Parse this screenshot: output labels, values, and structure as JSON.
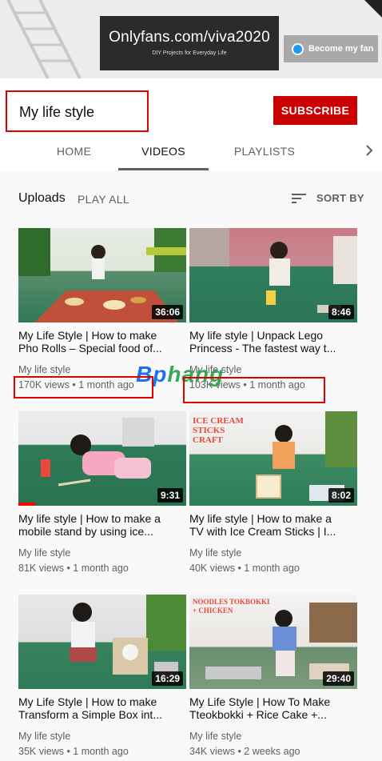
{
  "banner": {
    "title": "Onlyfans.com/viva2020",
    "subtitle": "DIY Projects for Everyday Life",
    "become_fan": "Become my fan"
  },
  "channel": {
    "name": "My life style",
    "subscribe_label": "SUBSCRIBE"
  },
  "tabs": [
    {
      "label": "HOME",
      "active": false
    },
    {
      "label": "VIDEOS",
      "active": true
    },
    {
      "label": "PLAYLISTS",
      "active": false
    }
  ],
  "uploads": {
    "title": "Uploads",
    "play_all": "PLAY ALL",
    "sort_by": "SORT BY"
  },
  "videos": [
    {
      "title_line1": "My Life Style | How to make",
      "title_line2": "Pho Rolls – Special food of...",
      "channel": "My life style",
      "meta": "170K views • 1 month ago",
      "duration": "36:06",
      "watched": 0,
      "thumb_text": "",
      "thumb_text2": ""
    },
    {
      "title_line1": "My life style | Unpack Lego",
      "title_line2": "Princess - The fastest way t...",
      "channel": "My life style",
      "meta": "103K views • 1 month ago",
      "duration": "8:46",
      "watched": 0,
      "thumb_text": "",
      "thumb_text2": ""
    },
    {
      "title_line1": "My life style | How to make a",
      "title_line2": "mobile stand by using ice...",
      "channel": "My life style",
      "meta": "81K views • 1 month ago",
      "duration": "9:31",
      "watched": 0.1,
      "thumb_text": "",
      "thumb_text2": ""
    },
    {
      "title_line1": "My life style | How to make a",
      "title_line2": "TV with Ice Cream Sticks | I...",
      "channel": "My life style",
      "meta": "40K views • 1 month ago",
      "duration": "8:02",
      "watched": 0,
      "thumb_text": "ICE CREAM STICKS",
      "thumb_text2": "CRAFT"
    },
    {
      "title_line1": "My Life Style | How to make",
      "title_line2": "Transform a Simple Box int...",
      "channel": "My life style",
      "meta": "35K views • 1 month ago",
      "duration": "16:29",
      "watched": 0,
      "thumb_text": "",
      "thumb_text2": ""
    },
    {
      "title_line1": "My Life Style | How To Make",
      "title_line2": "Tteokbokki + Rice Cake +...",
      "channel": "My life style",
      "meta": "34K views • 2 weeks ago",
      "duration": "29:40",
      "watched": 0,
      "thumb_text": "NOODLES TOKBOKKI",
      "thumb_text2": "+ CHICKEN"
    }
  ],
  "watermark": {
    "part1": "Bp",
    "part2": "hang"
  },
  "colors": {
    "subscribe": "#cc0000",
    "annotation_box": "#e00000",
    "progress": "#ff0000",
    "watermark_blue": "#1a73e8",
    "watermark_green": "#34a853"
  }
}
